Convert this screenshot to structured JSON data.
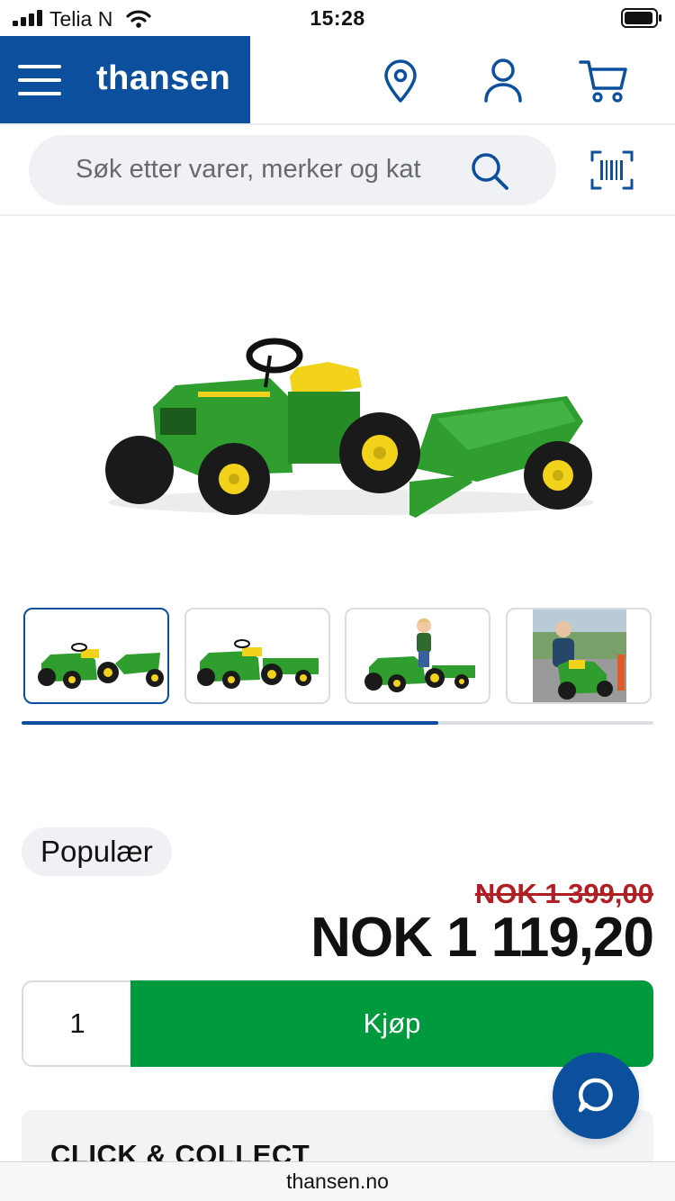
{
  "status_bar": {
    "carrier": "Telia N",
    "time": "15:28"
  },
  "header": {
    "logo": "thansen",
    "icons": [
      "menu-icon",
      "location-pin-icon",
      "account-icon",
      "cart-icon"
    ]
  },
  "search": {
    "placeholder": "Søk etter varer, merker og kat",
    "icons": [
      "search-icon",
      "barcode-scanner-icon"
    ]
  },
  "gallery": {
    "thumbnail_count": 4,
    "active_index": 0,
    "scroll_progress": 0.66
  },
  "product": {
    "badge": "Populær",
    "old_price": "NOK 1 399,00",
    "price": "NOK 1 119,20",
    "quantity": "1",
    "buy_label": "Kjøp"
  },
  "click_collect": {
    "title": "CLICK & COLLECT"
  },
  "browser": {
    "url": "thansen.no"
  },
  "colors": {
    "brand_blue": "#0b4f9d",
    "buy_green": "#009a3e",
    "old_price_red": "#b01f24",
    "tractor_green": "#2f9e2f",
    "tractor_yellow": "#f2d21b"
  }
}
